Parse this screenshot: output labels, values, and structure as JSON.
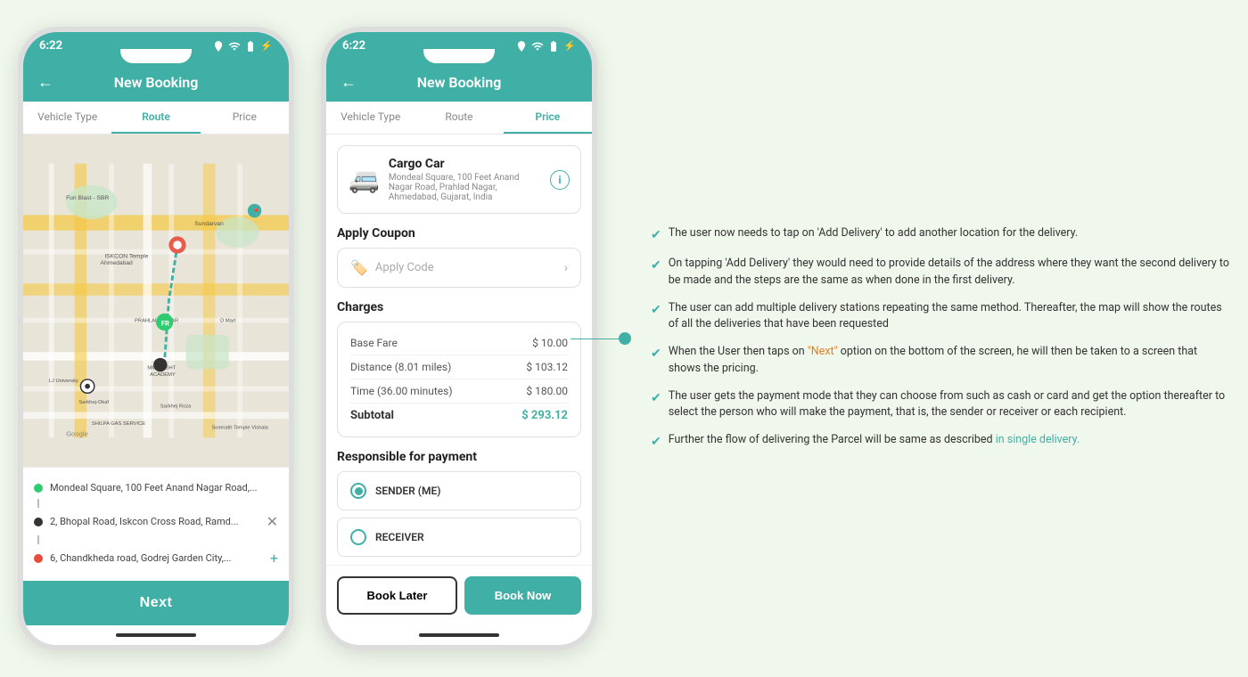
{
  "phone1": {
    "statusBar": {
      "time": "6:22",
      "icons": [
        "location",
        "wifi",
        "battery"
      ]
    },
    "header": {
      "backLabel": "←",
      "title": "New Booking"
    },
    "tabs": [
      {
        "label": "Vehicle Type",
        "active": false
      },
      {
        "label": "Route",
        "active": true
      },
      {
        "label": "Price",
        "active": false
      }
    ],
    "locations": [
      {
        "type": "green",
        "text": "Mondeal Square, 100 Feet Anand Nagar Road,...",
        "action": ""
      },
      {
        "type": "black",
        "text": "2, Bhopal Road, Iskcon Cross Road, Ramd...",
        "action": "✕"
      },
      {
        "type": "red",
        "text": "6, Chandkheda road, Godrej Garden City,...",
        "action": "+"
      }
    ],
    "nextButton": "Next"
  },
  "phone2": {
    "statusBar": {
      "time": "6:22"
    },
    "header": {
      "backLabel": "←",
      "title": "New Booking"
    },
    "tabs": [
      {
        "label": "Vehicle Type",
        "active": false
      },
      {
        "label": "Route",
        "active": false
      },
      {
        "label": "Price",
        "active": true
      }
    ],
    "vehicle": {
      "name": "Cargo Car",
      "address": "Mondeal Square, 100 Feet Anand Nagar Road, Prahlad Nagar, Ahmedabad, Gujarat, India",
      "infoIcon": "i"
    },
    "applyCoupon": {
      "sectionTitle": "Apply Coupon",
      "placeholder": "Apply Code",
      "icon": "%"
    },
    "charges": {
      "sectionTitle": "Charges",
      "rows": [
        {
          "label": "Base Fare",
          "amount": "$ 10.00"
        },
        {
          "label": "Distance (8.01 miles)",
          "amount": "$ 103.12"
        },
        {
          "label": "Time (36.00 minutes)",
          "amount": "$ 180.00"
        },
        {
          "label": "Subtotal",
          "amount": "$ 293.12",
          "isSubtotal": true
        }
      ]
    },
    "payment": {
      "sectionTitle": "Responsible for payment",
      "options": [
        {
          "label": "SENDER (ME)",
          "selected": true
        },
        {
          "label": "RECEIVER",
          "selected": false
        }
      ]
    },
    "buttons": {
      "bookLater": "Book Later",
      "bookNow": "Book Now"
    }
  },
  "annotations": [
    {
      "text": "The user now needs to tap on 'Add Delivery' to add another location for the delivery.",
      "hasHighlight": false
    },
    {
      "text": "On tapping 'Add Delivery' they would need to provide details of the address where they want the second delivery to be made and the steps are the same as when done in the first delivery.",
      "hasHighlight": false
    },
    {
      "text": "The user can add multiple delivery stations repeating the same method. Thereafter, the map will show the routes of all the deliveries that have been requested",
      "hasHighlight": false
    },
    {
      "text": "When the User then taps on \"Next\" option on the bottom of the screen, he will then be taken to a screen that shows the pricing.",
      "highlightStart": "\"Next\"",
      "highlightColor": "orange"
    },
    {
      "text": "The user gets the payment mode that they can choose from such as cash or card and get the option thereafter to select the person who will make the payment, that is, the sender or receiver or each recipient.",
      "hasHighlight": false
    },
    {
      "text": "Further the flow of delivering the Parcel will be same as described in single delivery.",
      "highlightPhrase": "in single delivery.",
      "highlightColor": "teal"
    }
  ]
}
